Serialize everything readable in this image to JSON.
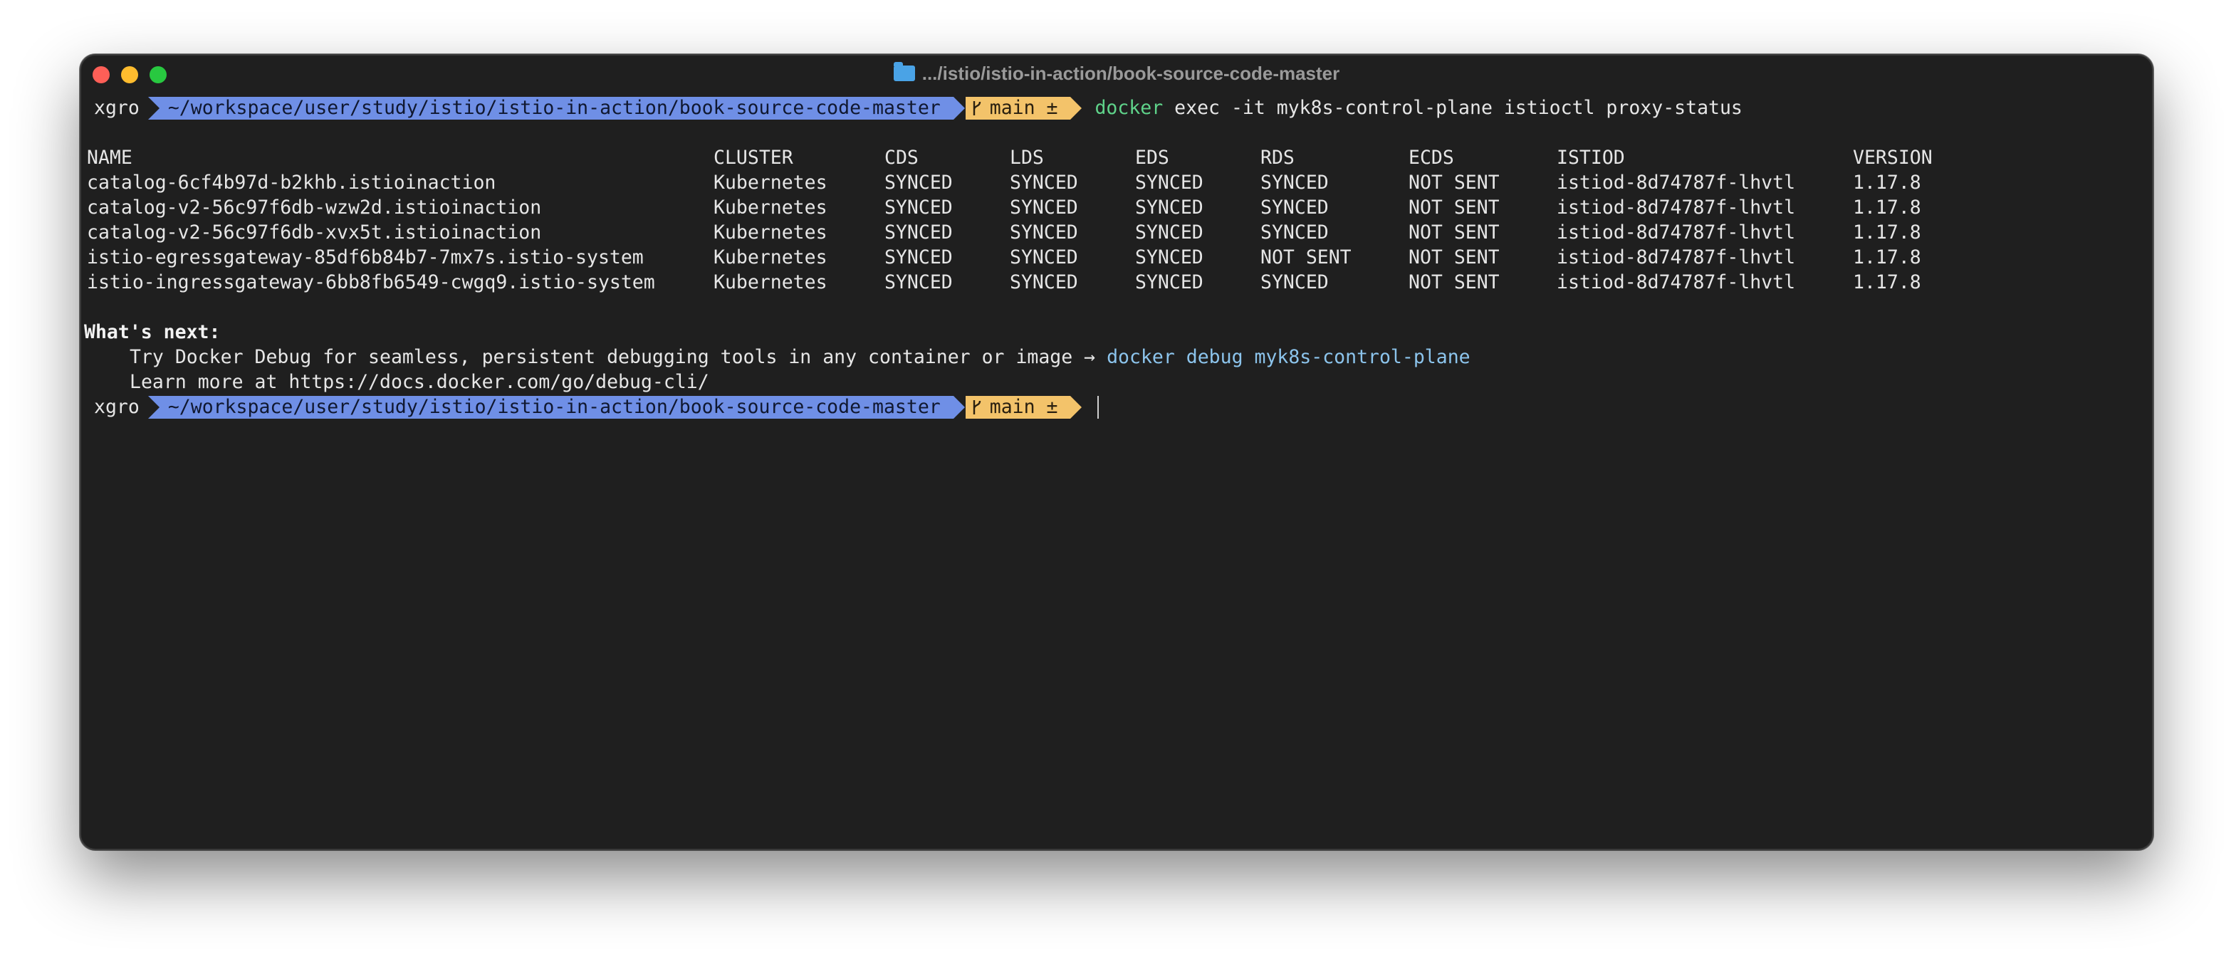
{
  "window": {
    "title": ".../istio/istio-in-action/book-source-code-master"
  },
  "prompt": {
    "user": "xgro",
    "path": "~/workspace/user/study/istio/istio-in-action/book-source-code-master",
    "branch_icon": "git-branch-icon",
    "branch": "main ±"
  },
  "command": {
    "name": "docker",
    "args": "exec -it myk8s-control-plane istioctl proxy-status"
  },
  "table": {
    "headers": [
      "NAME",
      "CLUSTER",
      "CDS",
      "LDS",
      "EDS",
      "RDS",
      "ECDS",
      "ISTIOD",
      "VERSION"
    ],
    "rows": [
      [
        "catalog-6cf4b97d-b2khb.istioinaction",
        "Kubernetes",
        "SYNCED",
        "SYNCED",
        "SYNCED",
        "SYNCED",
        "NOT SENT",
        "istiod-8d74787f-lhvtl",
        "1.17.8"
      ],
      [
        "catalog-v2-56c97f6db-wzw2d.istioinaction",
        "Kubernetes",
        "SYNCED",
        "SYNCED",
        "SYNCED",
        "SYNCED",
        "NOT SENT",
        "istiod-8d74787f-lhvtl",
        "1.17.8"
      ],
      [
        "catalog-v2-56c97f6db-xvx5t.istioinaction",
        "Kubernetes",
        "SYNCED",
        "SYNCED",
        "SYNCED",
        "SYNCED",
        "NOT SENT",
        "istiod-8d74787f-lhvtl",
        "1.17.8"
      ],
      [
        "istio-egressgateway-85df6b84b7-7mx7s.istio-system",
        "Kubernetes",
        "SYNCED",
        "SYNCED",
        "SYNCED",
        "NOT SENT",
        "NOT SENT",
        "istiod-8d74787f-lhvtl",
        "1.17.8"
      ],
      [
        "istio-ingressgateway-6bb8fb6549-cwgq9.istio-system",
        "Kubernetes",
        "SYNCED",
        "SYNCED",
        "SYNCED",
        "SYNCED",
        "NOT SENT",
        "istiod-8d74787f-lhvtl",
        "1.17.8"
      ]
    ]
  },
  "next": {
    "heading": "What's next:",
    "line1_text": "Try Docker Debug for seamless, persistent debugging tools in any container or image → ",
    "line1_cmd": "docker debug myk8s-control-plane",
    "line2_text": "Learn more at https://docs.docker.com/go/debug-cli/"
  },
  "colors": {
    "background": "#1f1f1f",
    "path_segment": "#6f8fe6",
    "git_segment": "#f3c36a",
    "command": "#5fd38a",
    "hint_command": "#8cc4ec"
  }
}
